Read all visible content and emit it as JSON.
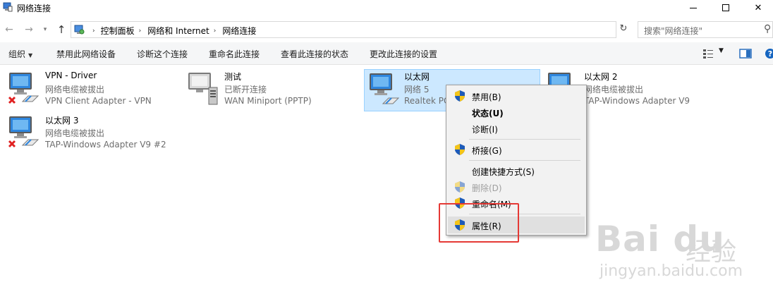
{
  "window": {
    "title": "网络连接"
  },
  "address": {
    "crumbs": [
      "控制面板",
      "网络和 Internet",
      "网络连接"
    ]
  },
  "search": {
    "placeholder": "搜索\"网络连接\""
  },
  "commands": {
    "organize": "组织",
    "disable": "禁用此网络设备",
    "diagnose": "诊断这个连接",
    "rename": "重命名此连接",
    "view_status": "查看此连接的状态",
    "change_settings": "更改此连接的设置"
  },
  "connections": [
    {
      "name": "VPN - Driver",
      "status": "网络电缆被拔出",
      "device": "VPN Client Adapter - VPN",
      "icon": "network-disconnected-icon"
    },
    {
      "name": "测试",
      "status": "已断开连接",
      "device": "WAN Miniport (PPTP)",
      "icon": "dialup-connection-icon"
    },
    {
      "name": "以太网",
      "status": "网络 5",
      "device": "Realtek PC",
      "icon": "network-connected-icon",
      "selected": true
    },
    {
      "name": "以太网 2",
      "status": "网络电缆被拔出",
      "device": "TAP-Windows Adapter V9",
      "icon": "network-disconnected-icon"
    },
    {
      "name": "以太网 3",
      "status": "网络电缆被拔出",
      "device": "TAP-Windows Adapter V9 #2",
      "icon": "network-disconnected-icon"
    }
  ],
  "context_menu": {
    "items": [
      {
        "label": "禁用(B)",
        "shield": true
      },
      {
        "label": "状态(U)",
        "bold": true
      },
      {
        "label": "诊断(I)"
      },
      {
        "label": "桥接(G)",
        "shield": true
      },
      {
        "label": "创建快捷方式(S)"
      },
      {
        "label": "删除(D)",
        "shield": true,
        "disabled": true
      },
      {
        "label": "重命名(M)",
        "shield": true
      },
      {
        "label": "属性(R)",
        "shield": true,
        "highlighted": true
      }
    ]
  },
  "watermark": {
    "logo": "Bai du",
    "cn": "经验",
    "url": "jingyan.baidu.com"
  },
  "colors": {
    "selection": "#cce8ff",
    "highlight_box": "#e53935",
    "error_x": "#e02020",
    "shield_blue": "#1e5bb8",
    "shield_yellow": "#f5c518"
  }
}
